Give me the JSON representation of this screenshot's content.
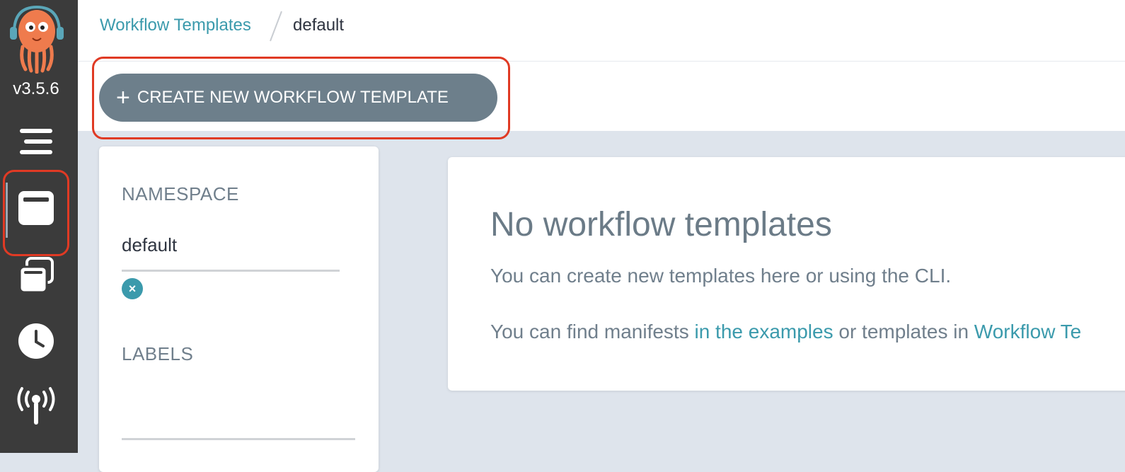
{
  "app": {
    "version": "v3.5.6"
  },
  "sidebar": {
    "items": [
      {
        "icon": "menu-icon"
      },
      {
        "icon": "workflow-templates-icon",
        "active": true
      },
      {
        "icon": "cluster-workflow-templates-icon"
      },
      {
        "icon": "cron-workflows-icon"
      },
      {
        "icon": "event-sources-icon"
      }
    ]
  },
  "breadcrumb": {
    "parent": "Workflow Templates",
    "current": "default"
  },
  "toolbar": {
    "create_plus": "+",
    "create_label": "CREATE NEW WORKFLOW TEMPLATE"
  },
  "filters": {
    "namespace_title": "NAMESPACE",
    "namespace_value": "default",
    "clear_symbol": "×",
    "labels_title": "LABELS"
  },
  "empty_state": {
    "title": "No workflow templates",
    "line1": "You can create new templates here or using the CLI.",
    "line2_prefix": "You can find manifests ",
    "line2_link1": "in the examples",
    "line2_middle": " or templates in ",
    "line2_link2": "Workflow Te"
  },
  "colors": {
    "accent": "#3b9aac",
    "sidebar_bg": "#3b3b3b",
    "button_bg": "#6d7f8b",
    "highlight": "#e03a24",
    "page_bg": "#dee4ec"
  }
}
